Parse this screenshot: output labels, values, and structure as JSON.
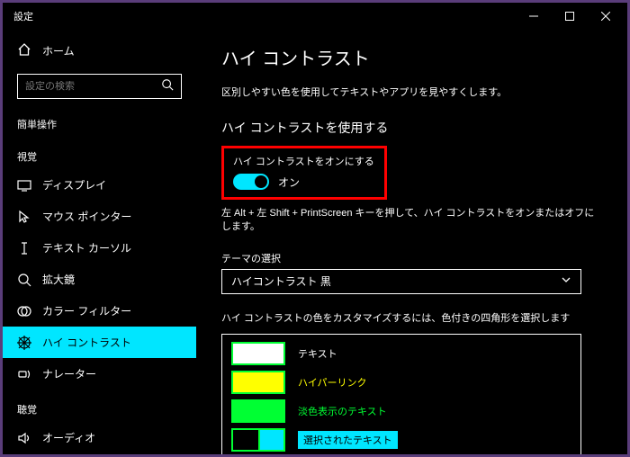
{
  "window": {
    "title": "設定"
  },
  "sidebar": {
    "home": "ホーム",
    "searchPlaceholder": "設定の検索",
    "category": "簡単操作",
    "groups": {
      "vision": "視覚",
      "hearing": "聴覚"
    },
    "items": {
      "display": "ディスプレイ",
      "mousePointer": "マウス ポインター",
      "textCursor": "テキスト カーソル",
      "magnifier": "拡大鏡",
      "colorFilters": "カラー フィルター",
      "highContrast": "ハイ コントラスト",
      "narrator": "ナレーター",
      "audio": "オーディオ"
    }
  },
  "content": {
    "title": "ハイ コントラスト",
    "description": "区別しやすい色を使用してテキストやアプリを見やすくします。",
    "useSectionTitle": "ハイ コントラストを使用する",
    "toggleLabel": "ハイ コントラストをオンにする",
    "toggleState": "オン",
    "shortcutHint": "左 Alt + 左 Shift + PrintScreen キーを押して、ハイ コントラストをオンまたはオフにします。",
    "themeLabel": "テーマの選択",
    "themeValue": "ハイコントラスト 黒",
    "customizeHint": "ハイ コントラストの色をカスタマイズするには、色付きの四角形を選択します",
    "swatches": {
      "text": "テキスト",
      "hyperlink": "ハイパーリンク",
      "disabledText": "淡色表示のテキスト",
      "selectedText": "選択されたテキスト"
    }
  }
}
